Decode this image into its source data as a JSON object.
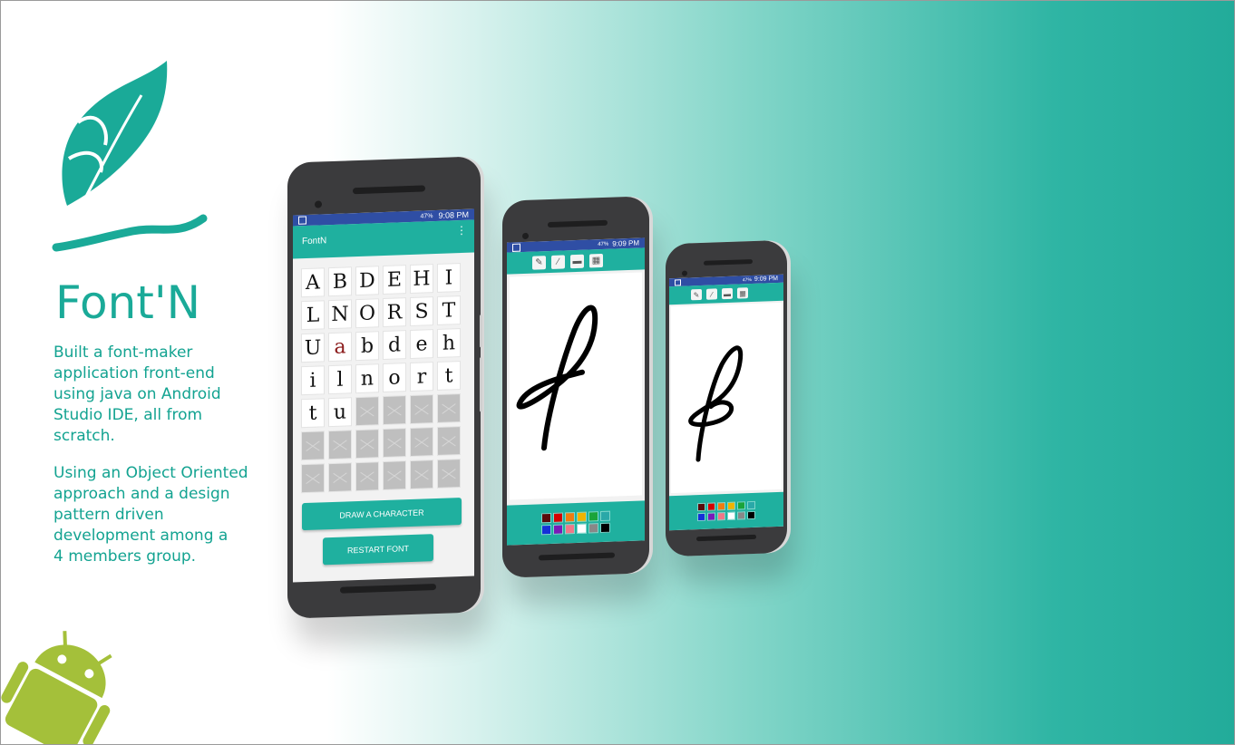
{
  "title": "Font'N",
  "description": [
    "Built a font-maker\napplication front-end\nusing java on Android\nStudio IDE, all from\nscratch.",
    "Using an Object Oriented\napproach and a design\npattern driven\ndevelopment among a\n 4 members group."
  ],
  "phone_main": {
    "status_time": "9:08 PM",
    "battery": "47%",
    "app_name": "FontN",
    "glyphs": [
      "A",
      "B",
      "D",
      "E",
      "H",
      "I",
      "L",
      "N",
      "O",
      "R",
      "S",
      "T",
      "U",
      "a",
      "b",
      "d",
      "e",
      "h",
      "i",
      "l",
      "n",
      "o",
      "r",
      "t",
      "t",
      "u"
    ],
    "empty_cells": 16,
    "draw_button": "DRAW A CHARACTER",
    "restart_button": "RESTART FONT"
  },
  "phone_mid": {
    "status_time": "9:09 PM",
    "battery": "47%"
  },
  "phone_small": {
    "status_time": "9:09 PM",
    "battery": "47%"
  },
  "colors": {
    "accent": "#1fb09f",
    "statusbar": "#2f4ea4",
    "palette": [
      "#5a0a0a",
      "#d40000",
      "#f07c10",
      "#f0b400",
      "#1aa43a",
      "#2aa8a8",
      "#1530d8",
      "#7a1ab8",
      "#f07888",
      "#ffffff",
      "#888888",
      "#000000"
    ]
  },
  "icons": [
    "feather-quill-icon",
    "android-robot-icon",
    "note-tool-icon",
    "brush-tool-icon",
    "eraser-tool-icon",
    "save-tool-icon",
    "menu-overflow-icon"
  ]
}
